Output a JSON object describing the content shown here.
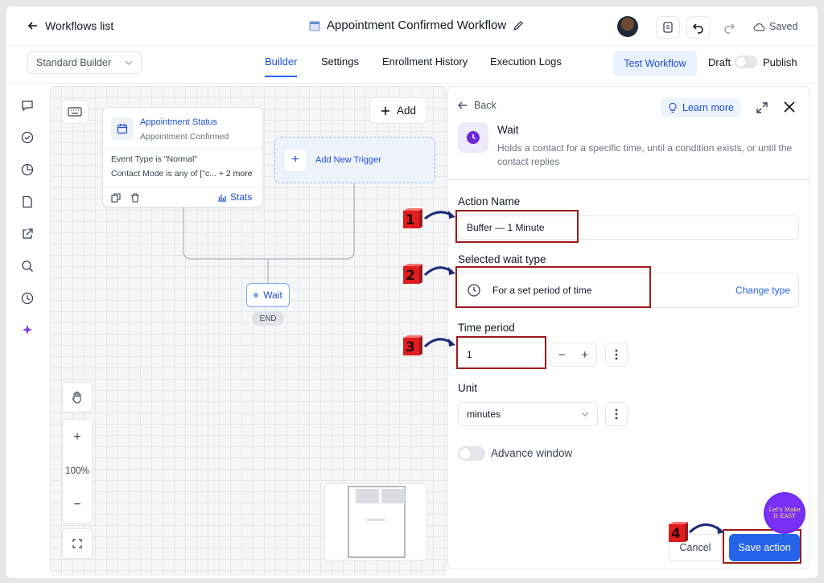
{
  "header": {
    "back_label": "Workflows list",
    "title": "Appointment Confirmed Workflow",
    "saved_label": "Saved"
  },
  "subbar": {
    "builder_select": "Standard Builder",
    "tabs": [
      {
        "label": "Builder",
        "active": true
      },
      {
        "label": "Settings",
        "active": false
      },
      {
        "label": "Enrollment History",
        "active": false
      },
      {
        "label": "Execution Logs",
        "active": false
      }
    ],
    "test_button": "Test Workflow",
    "draft_label": "Draft",
    "publish_label": "Publish"
  },
  "canvas": {
    "add_label": "Add",
    "trigger": {
      "title": "Appointment Status",
      "subtitle": "Appointment Confirmed",
      "line1": "Event Type is \"Normal\"",
      "line2": "Contact Mode is any of [\"c...",
      "more": "+ 2 more",
      "stats_label": "Stats"
    },
    "add_new_trigger": "Add New Trigger",
    "wait_node": "Wait",
    "end_label": "END",
    "zoom_level": "100%"
  },
  "panel": {
    "back_label": "Back",
    "learn_more": "Learn more",
    "heading": "Wait",
    "description": "Holds a contact for a specific time, until a condition exists, or until the contact replies",
    "action_name_label": "Action Name",
    "action_name_value": "Buffer — 1 Minute",
    "wait_type_label": "Selected wait type",
    "wait_type_value": "For a set period of time",
    "change_type": "Change type",
    "time_period_label": "Time period",
    "time_period_value": "1",
    "unit_label": "Unit",
    "unit_value": "minutes",
    "advance_window_label": "Advance window",
    "cancel_label": "Cancel",
    "save_label": "Save action"
  },
  "annotations": {
    "step1": "1",
    "step2": "2",
    "step3": "3",
    "step4": "4",
    "watermark": "Let's Make It EASY"
  },
  "colors": {
    "accent": "#2563eb",
    "annotation_red": "#9b1c1c",
    "annotation_arrow": "#1e2a78",
    "wait_purple": "#6d28d9"
  }
}
